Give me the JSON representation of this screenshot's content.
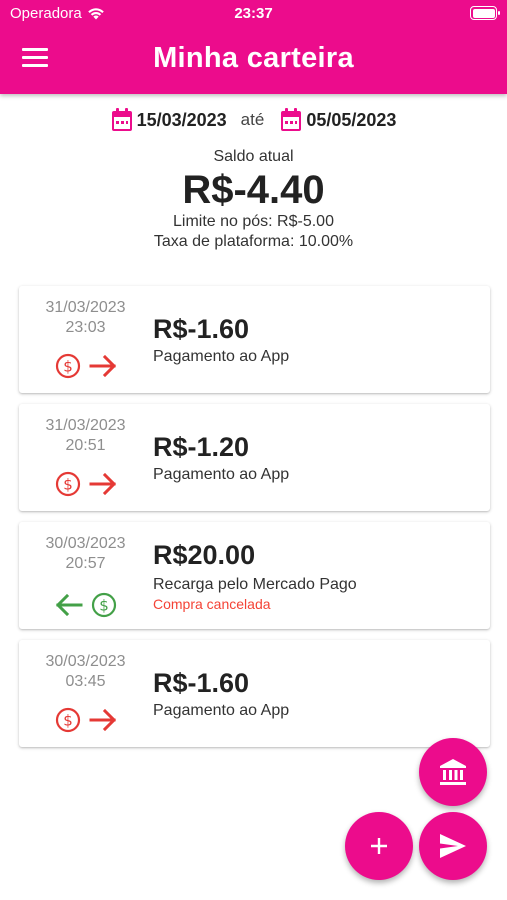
{
  "status_bar": {
    "carrier": "Operadora",
    "time": "23:37"
  },
  "header": {
    "title": "Minha carteira"
  },
  "date_filter": {
    "start": "15/03/2023",
    "separator": "até",
    "end": "05/05/2023"
  },
  "balance": {
    "label": "Saldo atual",
    "amount": "R$-4.40",
    "limit": "Limite no pós: R$-5.00",
    "fee": "Taxa de plataforma: 10.00%"
  },
  "transactions": [
    {
      "date": "31/03/2023",
      "time": "23:03",
      "value": "R$-1.60",
      "description": "Pagamento ao App",
      "note": "",
      "direction": "out"
    },
    {
      "date": "31/03/2023",
      "time": "20:51",
      "value": "R$-1.20",
      "description": "Pagamento ao App",
      "note": "",
      "direction": "out"
    },
    {
      "date": "30/03/2023",
      "time": "20:57",
      "value": "R$20.00",
      "description": "Recarga pelo Mercado Pago",
      "note": "Compra cancelada",
      "direction": "in"
    },
    {
      "date": "30/03/2023",
      "time": "03:45",
      "value": "R$-1.60",
      "description": "Pagamento ao App",
      "note": "",
      "direction": "out"
    }
  ],
  "icons": {
    "menu": "hamburger-menu-icon",
    "calendar": "calendar-icon",
    "outgoing": [
      "dollar-circle-icon",
      "arrow-right-icon"
    ],
    "incoming": [
      "arrow-left-icon",
      "dollar-circle-icon"
    ],
    "bank": "bank-icon",
    "add": "plus-icon",
    "send": "send-icon"
  },
  "colors": {
    "primary": "#ec0c8c",
    "outgoing": "#e53935",
    "incoming": "#43a047",
    "cancel_note": "#f44336"
  }
}
